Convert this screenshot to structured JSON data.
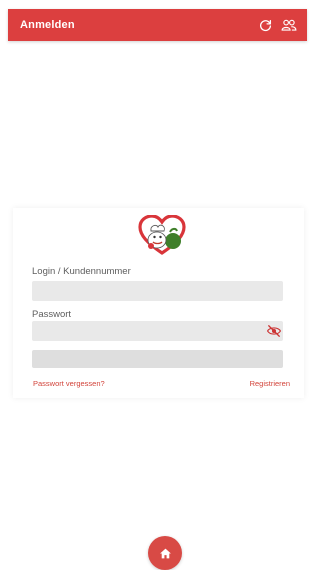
{
  "app_bar": {
    "title": "Anmelden",
    "refresh_icon": "refresh-icon",
    "account_icon": "users-icon",
    "color": "#dc3f3f"
  },
  "login_form": {
    "logo_icon": "heart-chef-logo",
    "login_label": "Login / Kundennummer",
    "login_value": "",
    "password_label": "Passwort",
    "password_value": "",
    "password_toggle_icon": "eye-off-icon",
    "submit_label": "",
    "forgot_password_link": "Passwort vergessen?",
    "register_link": "Registrieren",
    "link_color": "#d2433a"
  },
  "footer": {
    "home_icon": "home-icon",
    "color": "#d84a45"
  }
}
